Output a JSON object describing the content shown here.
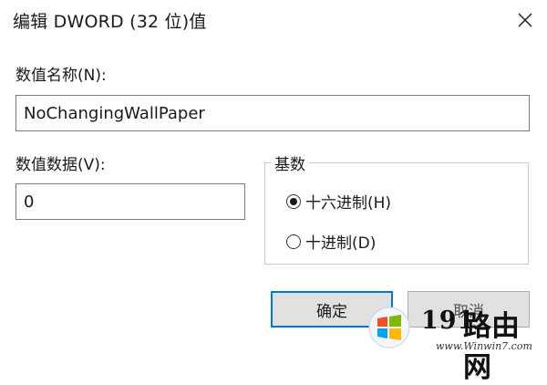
{
  "window": {
    "title": "编辑 DWORD (32 位)值",
    "close_icon": "close-icon"
  },
  "value_name": {
    "label": "数值名称(N):",
    "value": "NoChangingWallPaper"
  },
  "value_data": {
    "label": "数值数据(V):",
    "value": "0"
  },
  "base": {
    "legend": "基数",
    "options": [
      {
        "label": "十六进制(H)",
        "selected": true
      },
      {
        "label": "十进制(D)",
        "selected": false
      }
    ]
  },
  "buttons": {
    "ok": "确定",
    "cancel": "取消"
  },
  "watermark": {
    "number": "191",
    "name": "路由网",
    "url": "www.Winwin7.com",
    "logo_icon": "windows-logo-icon"
  },
  "colors": {
    "accent": "#0078d7",
    "button_face": "#e1e1e1"
  }
}
